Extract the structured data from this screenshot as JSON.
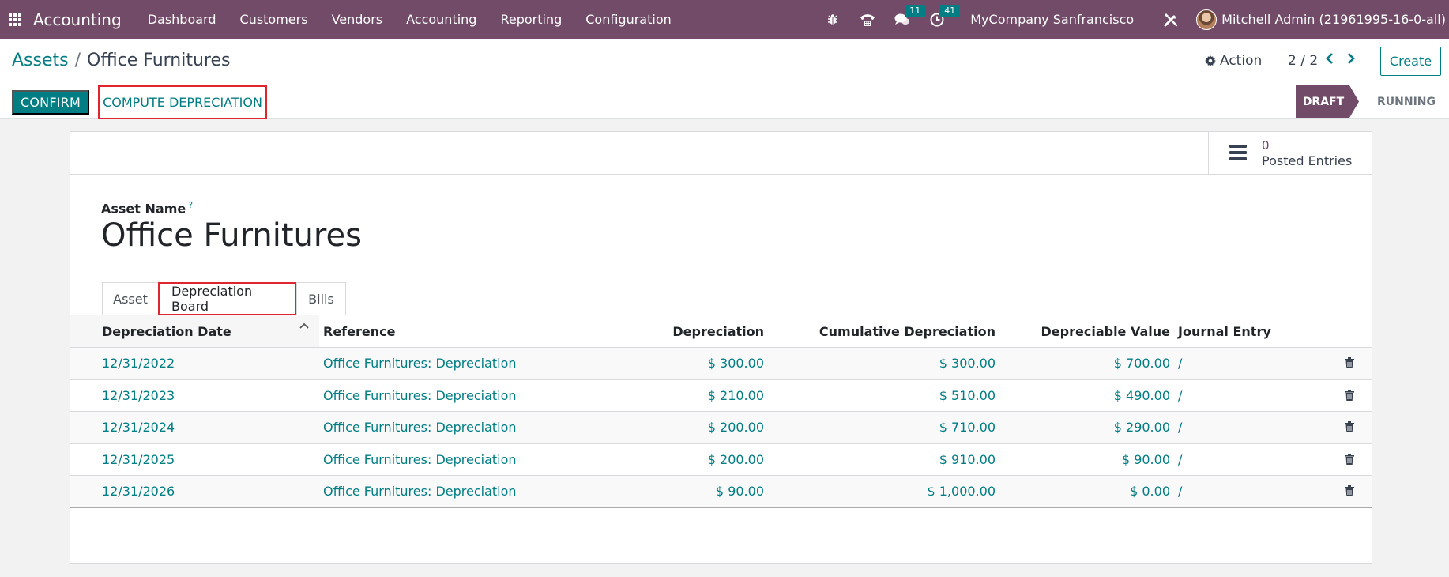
{
  "navbar": {
    "brand": "Accounting",
    "menu": [
      "Dashboard",
      "Customers",
      "Vendors",
      "Accounting",
      "Reporting",
      "Configuration"
    ],
    "messages_count": "11",
    "activities_count": "41",
    "company": "MyCompany Sanfrancisco",
    "user": "Mitchell Admin (21961995-16-0-all)"
  },
  "breadcrumb": {
    "parent": "Assets",
    "separator": "/",
    "current": "Office Furnitures"
  },
  "control": {
    "action_label": "Action",
    "pager": "2 / 2",
    "create_label": "Create"
  },
  "statusbar": {
    "confirm_label": "CONFIRM",
    "compute_label": "COMPUTE DEPRECIATION",
    "states": [
      "DRAFT",
      "RUNNING"
    ],
    "active_state": "DRAFT"
  },
  "smart_button": {
    "value": "0",
    "label": "Posted Entries"
  },
  "form": {
    "asset_name_label": "Asset Name",
    "help_marker": "?",
    "asset_name": "Office Furnitures"
  },
  "tabs": {
    "asset": "Asset",
    "depreciation_board": "Depreciation Board",
    "bills": "Bills",
    "active": "Depreciation Board"
  },
  "table": {
    "headers": [
      "Depreciation Date",
      "Reference",
      "Depreciation",
      "Cumulative Depreciation",
      "Depreciable Value",
      "Journal Entry"
    ],
    "rows": [
      {
        "date": "12/31/2022",
        "ref": "Office Furnitures: Depreciation",
        "dep": "$ 300.00",
        "cum": "$ 300.00",
        "val": "$ 700.00",
        "je": "/"
      },
      {
        "date": "12/31/2023",
        "ref": "Office Furnitures: Depreciation",
        "dep": "$ 210.00",
        "cum": "$ 510.00",
        "val": "$ 490.00",
        "je": "/"
      },
      {
        "date": "12/31/2024",
        "ref": "Office Furnitures: Depreciation",
        "dep": "$ 200.00",
        "cum": "$ 710.00",
        "val": "$ 290.00",
        "je": "/"
      },
      {
        "date": "12/31/2025",
        "ref": "Office Furnitures: Depreciation",
        "dep": "$ 200.00",
        "cum": "$ 910.00",
        "val": "$ 90.00",
        "je": "/"
      },
      {
        "date": "12/31/2026",
        "ref": "Office Furnitures: Depreciation",
        "dep": "$ 90.00",
        "cum": "$ 1,000.00",
        "val": "$ 0.00",
        "je": "/"
      }
    ]
  },
  "colors": {
    "brand": "#714b67",
    "accent": "#017e84",
    "highlight": "#e0252e"
  }
}
